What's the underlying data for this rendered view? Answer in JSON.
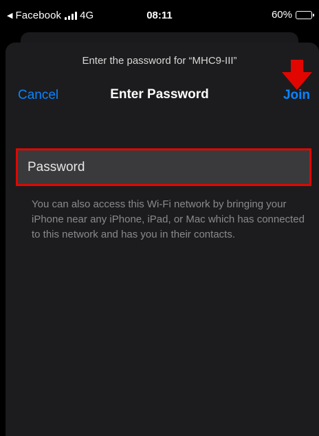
{
  "status_bar": {
    "back_app": "Facebook",
    "network": "4G",
    "time": "08:11",
    "battery": "60%",
    "battery_level": 0.6
  },
  "sheet": {
    "prompt": "Enter the password for “MHC9-III”",
    "title": "Enter Password",
    "cancel_label": "Cancel",
    "join_label": "Join"
  },
  "password_field": {
    "placeholder": "Password",
    "value": ""
  },
  "info_text": "You can also access this Wi-Fi network by bringing your iPhone near any iPhone, iPad, or Mac which has connected to this network and has you in their contacts.",
  "colors": {
    "accent": "#0a84ff",
    "highlight": "#e10600",
    "sheet_bg": "#1c1c1e"
  },
  "icons": {
    "annotation": "red-down-arrow-icon",
    "back": "back-triangle-icon",
    "signal": "signal-bars-icon",
    "battery": "battery-icon"
  }
}
